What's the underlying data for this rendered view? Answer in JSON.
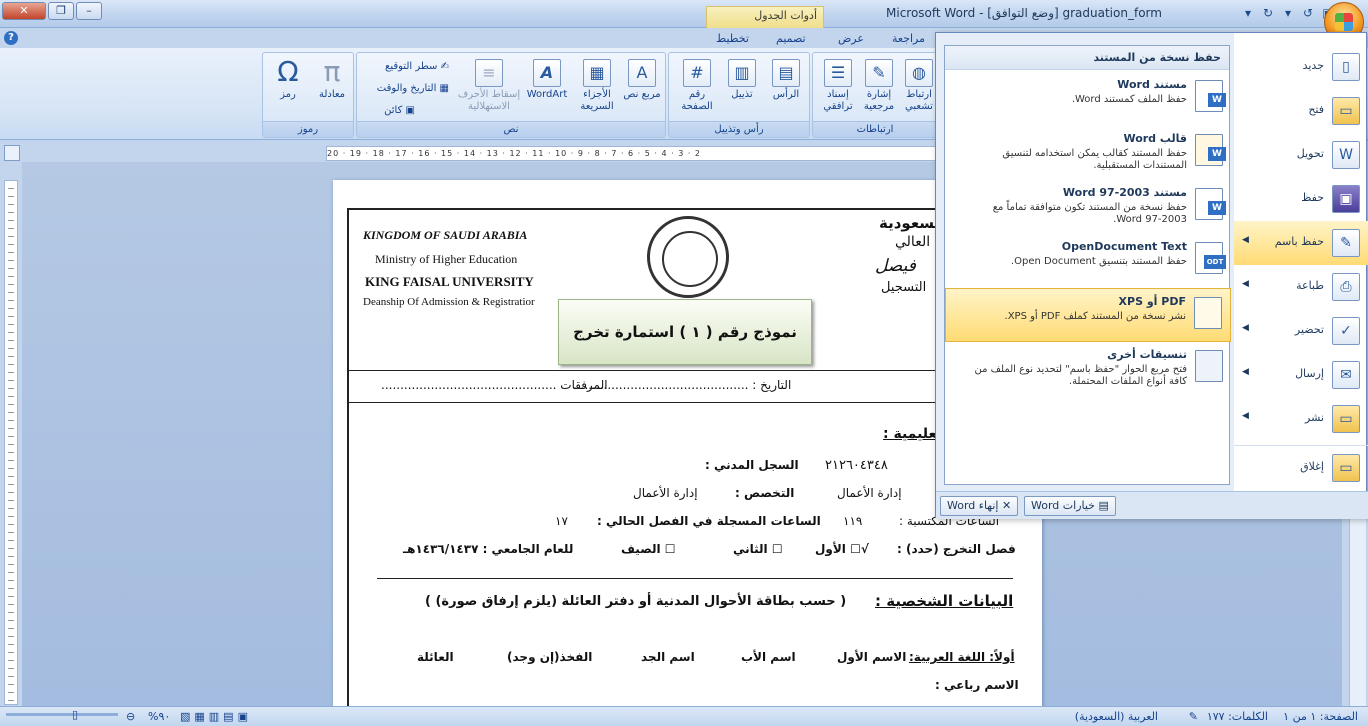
{
  "window": {
    "title": "graduation_form [وضع التوافق] - Microsoft Word",
    "context_tab": "أدوات الجدول"
  },
  "tabs": [
    "مراجعة",
    "عرض",
    "تصميم",
    "تخطيط"
  ],
  "ribbon": {
    "groups": {
      "links": "ارتباطات",
      "header_footer": "رأس وتذييل",
      "text": "نص",
      "symbols": "رموز"
    },
    "buttons": {
      "hyperlink": "ارتباط تشعبي",
      "bookmark": "إشارة مرجعية",
      "cross_ref": "إسناد ترافقي",
      "header": "الرأس",
      "footer": "تذييل",
      "page_number": "رقم الصفحة",
      "text_box": "مربع نص",
      "quick_parts": "الأجزاء السريعة",
      "wordart": "WordArt",
      "drop_cap": "إسقاط الأحرف الاستهلالية",
      "signature_line": "سطر التوقيع",
      "date_time": "التاريخ والوقت",
      "object": "كائن",
      "equation": "معادلة",
      "symbol": "رمز"
    }
  },
  "ruler": {
    "marks": "20 · 19 · 18 · 17 · 16 · 15 · 14 · 13 · 12 · 11 · 10 · 9 · 8 · 7 · 6 · 5 · 4 · 3 · 2"
  },
  "document": {
    "en_lines": [
      "KINGDOM OF SAUDI ARABIA",
      "Ministry of Higher Education",
      "KING FAISAL UNIVERSITY",
      "Deanship Of Admission & Registratior"
    ],
    "ar_header": [
      "السعودية",
      "العالي",
      "فيصل",
      "التسجيل"
    ],
    "form_title": "نموذج رقم ( ١ ) استمارة تخرج",
    "date_line": "التاريخ : ..............................................",
    "attachments_line": "المرفقات ..............................................",
    "section_edu": "تعليمية :",
    "civil_label": "السجل المدني :",
    "civil_value": "٢١٢٦٠٤٣٤٨",
    "major_label": "التخصص :",
    "major_value": "إدارة الأعمال",
    "college_value": "إدارة الأعمال",
    "earned_label": "الساعات المكتسبة :",
    "earned_value": "١١٩",
    "current_label": "الساعات المسجلة في الفصل الحالي :",
    "current_value": "١٧",
    "grad_label": "فصل التخرج (حدد) :",
    "grad_first": "√☐ الأول",
    "grad_second": "☐ الثاني",
    "grad_summer": "☐ الصيف",
    "grad_year": "للعام الجامعي : ١٤٣٦/١٤٣٧هـ",
    "personal_label": "البيانات الشخصية :",
    "personal_note": "(  حسب بطاقة الأحوال المدنية أو دفتر العائلة (يلزم إرفاق صورة)  )",
    "arabic_name": "أولاً: اللغة العربية:",
    "first_name": "الاسم الأول",
    "father_name": "اسم الأب",
    "grand_name": "اسم الجد",
    "tribe": "الفخذ(إن وجد)",
    "family": "العائلة",
    "quad_name": "الاسم رباعي :"
  },
  "office_menu": {
    "header": "حفظ نسخة من المستند",
    "left_items": [
      {
        "label": "جديد"
      },
      {
        "label": "فتح"
      },
      {
        "label": "تحويل"
      },
      {
        "label": "حفظ"
      },
      {
        "label": "حفظ باسم"
      },
      {
        "label": "طباعة"
      },
      {
        "label": "تحضير"
      },
      {
        "label": "إرسال"
      },
      {
        "label": "نشر"
      },
      {
        "label": "إغلاق"
      }
    ],
    "sub_items": [
      {
        "title": "مستند Word",
        "desc": "حفظ الملف كمستند Word.",
        "badge": "W"
      },
      {
        "title": "قالب Word",
        "desc": "حفظ المستند كقالب يمكن استخدامه لتنسيق المستندات المستقبلية.",
        "badge": "W"
      },
      {
        "title": "مستند Word 97-2003",
        "desc": "حفظ نسخة من المستند تكون متوافقة تماماً مع Word 97-2003.",
        "badge": "W"
      },
      {
        "title": "OpenDocument Text",
        "desc": "حفظ المستند بتنسيق Open Document.",
        "badge": "ODT"
      },
      {
        "title": "PDF أو XPS",
        "desc": "نشر نسخة من المستند كملف PDF أو XPS.",
        "badge": ""
      },
      {
        "title": "تنسيقات أخرى",
        "desc": "فتح مربع الحوار \"حفظ باسم\" لتحديد نوع الملف من كافة أنواع الملفات المحتملة.",
        "badge": ""
      }
    ],
    "options_btn": "خيارات Word",
    "exit_btn": "إنهاء Word"
  },
  "statusbar": {
    "page": "الصفحة: ١ من ١",
    "words": "الكلمات: ١٧٧",
    "lang": "العربية (السعودية)",
    "zoom": "٩٠%"
  },
  "colors": {
    "accent": "#15428b",
    "highlight": "#ffdb74"
  }
}
